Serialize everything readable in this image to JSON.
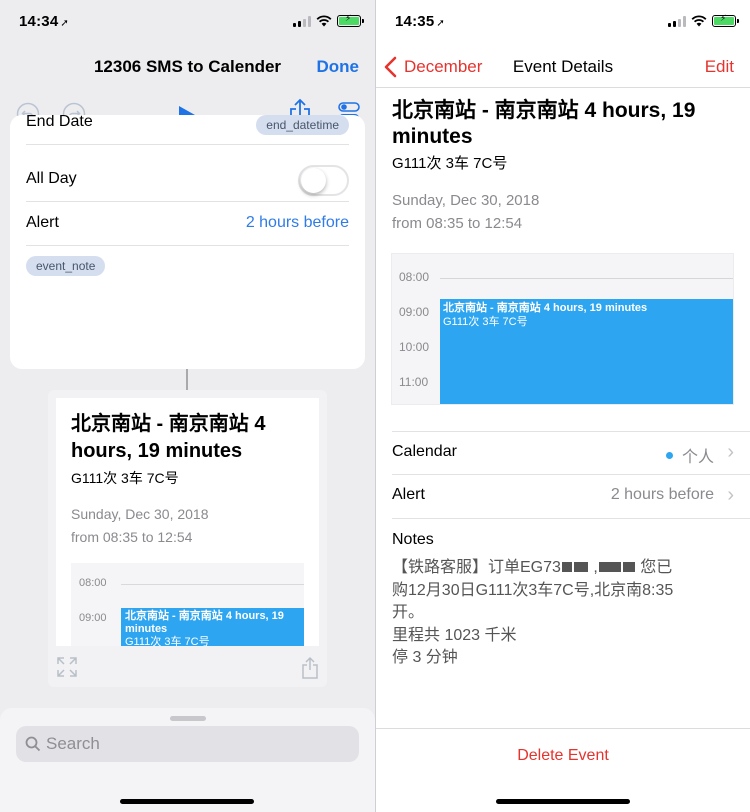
{
  "left": {
    "status": {
      "time": "14:34",
      "location_icon": "location-arrow"
    },
    "nav": {
      "title": "12306 SMS to Calender",
      "done": "Done"
    },
    "toolbar": {
      "icons": [
        "undo-icon",
        "redo-icon",
        "play-icon",
        "share-icon",
        "settings-toggle-icon"
      ]
    },
    "action": {
      "end_date_label": "End Date",
      "end_date_token": "end_datetime",
      "all_day_label": "All Day",
      "all_day_on": false,
      "alert_label": "Alert",
      "alert_value": "2 hours before",
      "notes_token": "event_note"
    },
    "preview": {
      "title": "北京南站 - 南京南站 4 hours, 19 minutes",
      "subtitle": "G111次 3车 7C号",
      "date": "Sunday, Dec 30, 2018",
      "time_range": "from 08:35 to 12:54",
      "hours": [
        "08:00",
        "09:00"
      ],
      "event_title": "北京南站 - 南京南站 4 hours, 19 minutes",
      "event_sub": "G111次 3车 7C号"
    },
    "search": {
      "placeholder": "Search"
    }
  },
  "right": {
    "status": {
      "time": "14:35"
    },
    "nav": {
      "back": "December",
      "title": "Event Details",
      "edit": "Edit"
    },
    "event": {
      "title": "北京南站 - 南京南站 4 hours, 19 minutes",
      "subtitle": "G111次 3车 7C号",
      "date": "Sunday, Dec 30, 2018",
      "time_range": "from 08:35 to 12:54"
    },
    "calendar": {
      "hours": [
        "08:00",
        "09:00",
        "10:00",
        "11:00"
      ],
      "event_title": "北京南站 - 南京南站 4 hours, 19 minutes",
      "event_sub": "G111次 3车 7C号"
    },
    "calendar_row": {
      "label": "Calendar",
      "value": "个人",
      "color": "#2ea5f0"
    },
    "alert_row": {
      "label": "Alert",
      "value": "2 hours before"
    },
    "notes": {
      "label": "Notes",
      "line1_a": "【铁路客服】订单EG73",
      "line1_b": "您已",
      "line2": "购12月30日G111次3车7C号,北京南8:35",
      "line3": "开。",
      "line4": "里程共 1023 千米",
      "line5": "停 3 分钟"
    },
    "delete": "Delete Event"
  },
  "colors": {
    "accent_blue": "#1f73e6",
    "accent_red": "#e5332e",
    "event_blue": "#2ea5f0"
  }
}
